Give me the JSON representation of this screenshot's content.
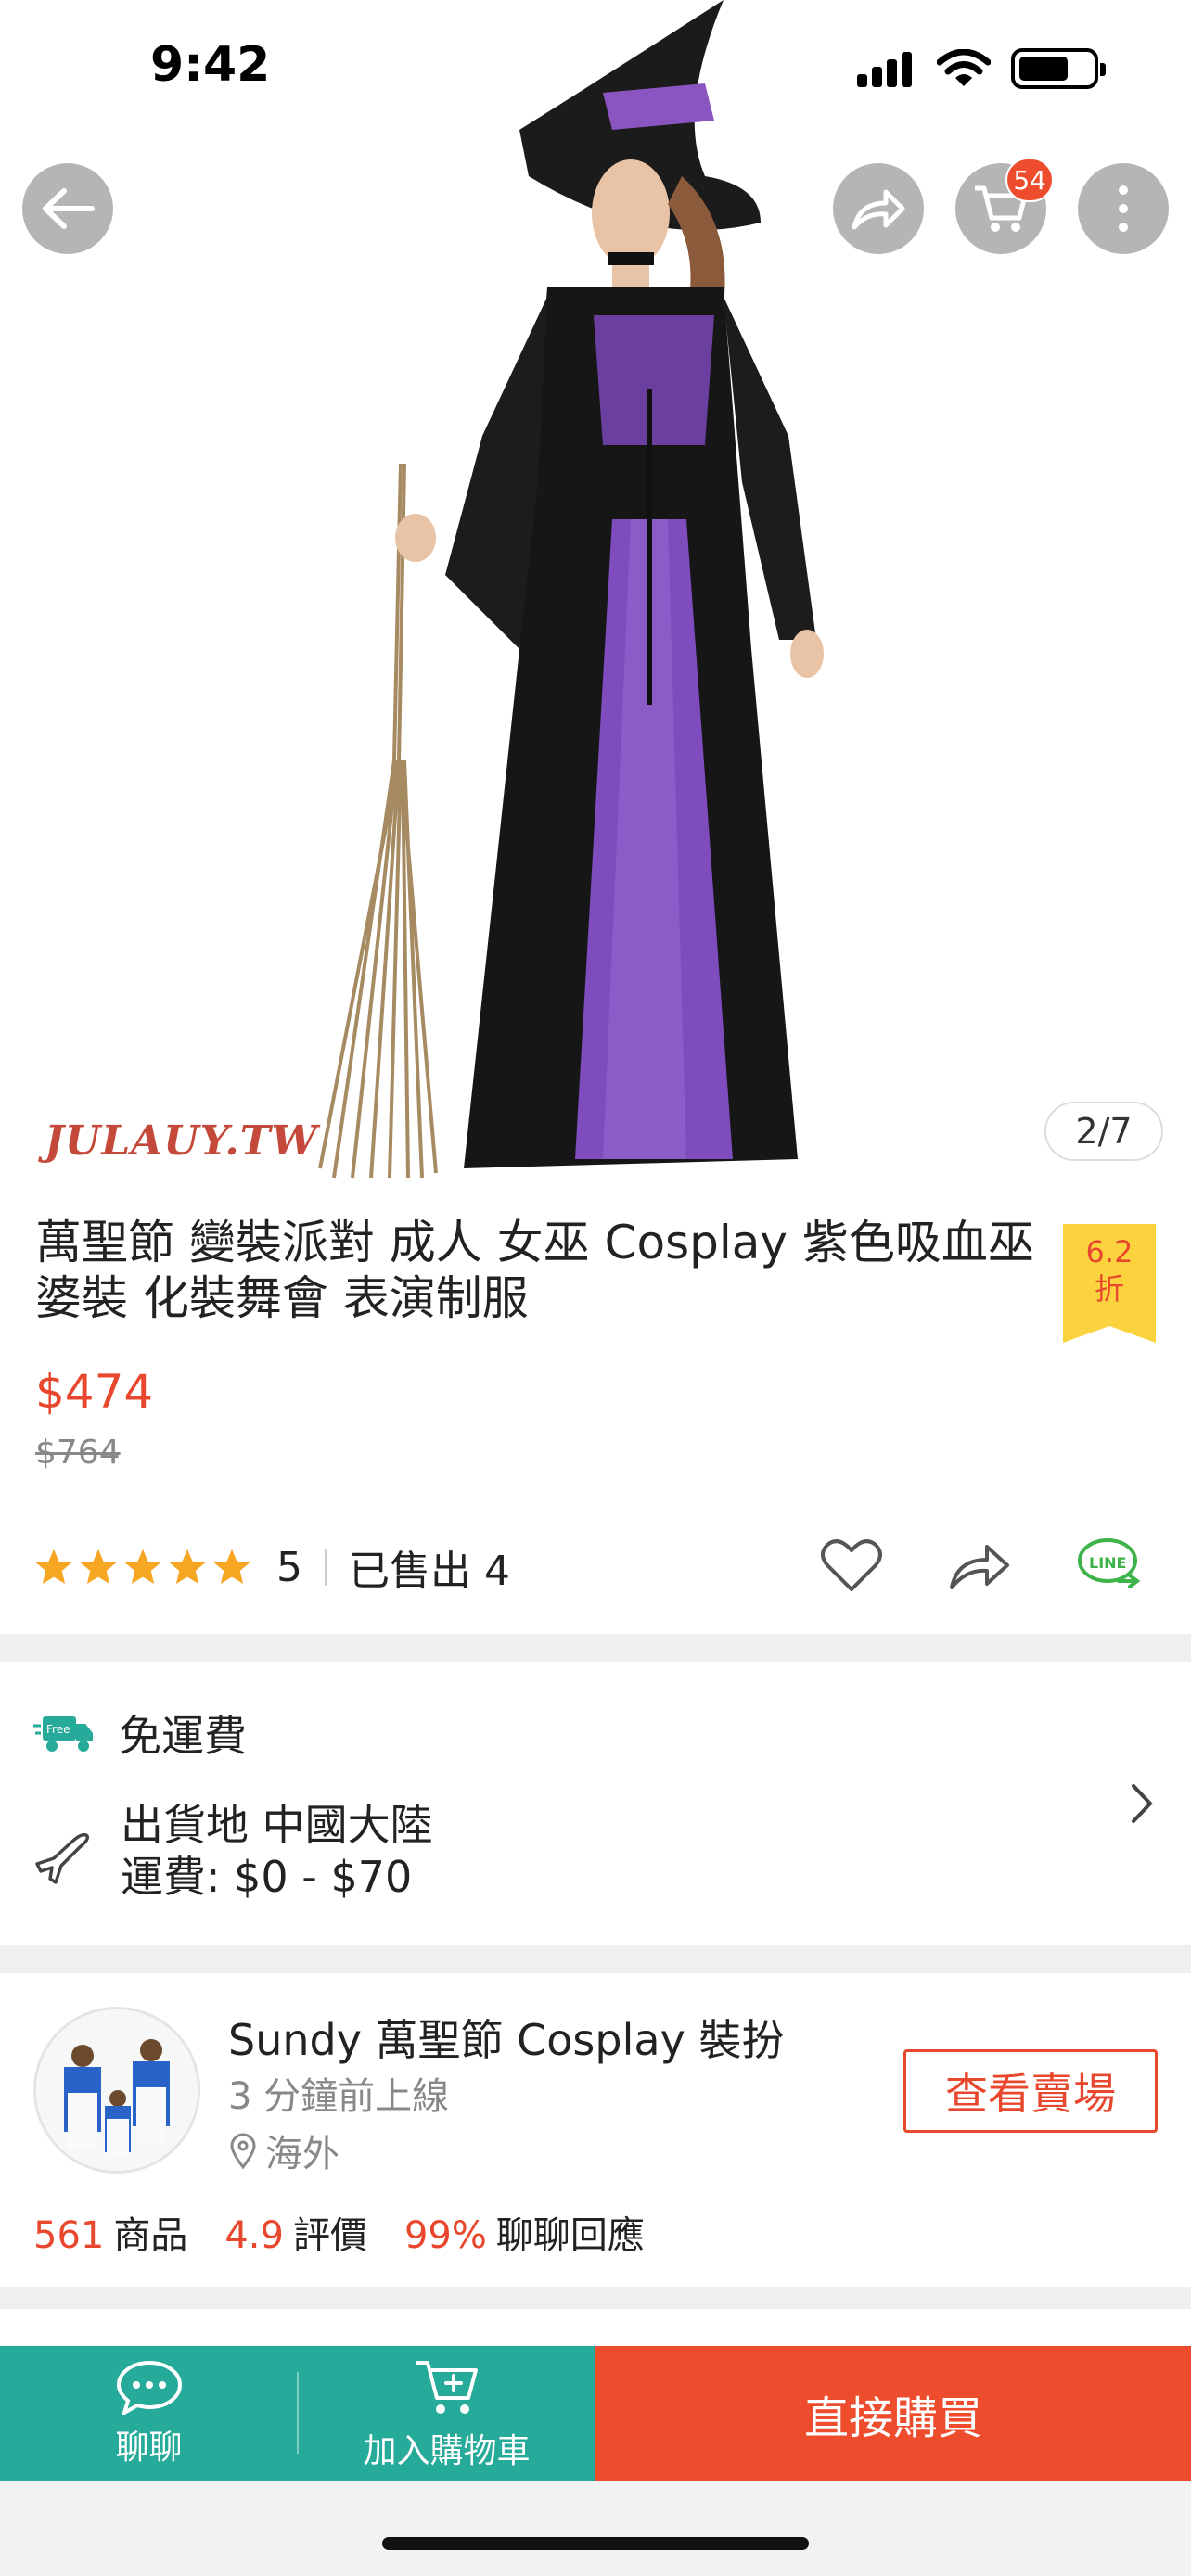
{
  "status_bar": {
    "time": "9:42"
  },
  "header": {
    "cart_count": "54"
  },
  "gallery": {
    "watermark": "JULAUY.TW",
    "counter": "2/7"
  },
  "product": {
    "title": "萬聖節 變裝派對 成人 女巫  Cosplay 紫色吸血巫婆裝 化裝舞會 表演制服",
    "discount_value": "6.2",
    "discount_unit": "折",
    "price": "$474",
    "original_price": "$764",
    "rating": "5",
    "rating_stars": 5,
    "sold": "已售出 4"
  },
  "shipping": {
    "free_label": "免運費",
    "free_badge": "Free",
    "origin": "出貨地 中國大陸",
    "fee": "運費: $0 - $70"
  },
  "shop": {
    "name": "Sundy 萬聖節 Cosplay 裝扮",
    "online": "3 分鐘前上線",
    "location": "海外",
    "view_button": "查看賣場",
    "stats": [
      {
        "value": "561",
        "label": "商品"
      },
      {
        "value": "4.9",
        "label": "評價"
      },
      {
        "value": "99%",
        "label": "聊聊回應"
      }
    ]
  },
  "bottom_bar": {
    "chat_label": "聊聊",
    "cart_label": "加入購物車",
    "buy_label": "直接購買"
  },
  "colors": {
    "accent": "#ee4d2d",
    "teal": "#26aa99",
    "discount_bg": "#fbd33f",
    "star": "#f6a623",
    "line_green": "#3db34a"
  }
}
